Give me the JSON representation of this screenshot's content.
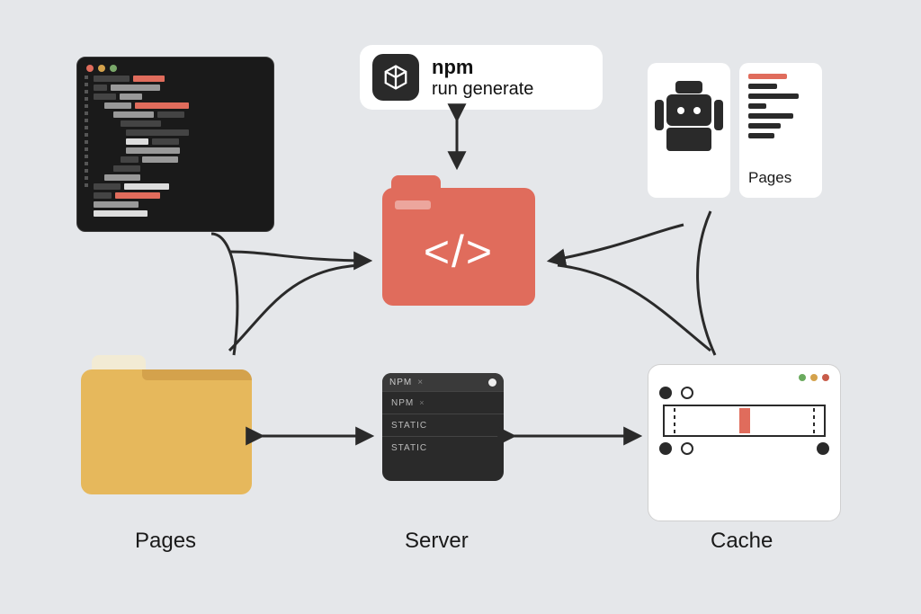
{
  "npm": {
    "cmd": "npm",
    "sub": "run generate"
  },
  "labels": {
    "pages_left": "Pages",
    "server": "Server",
    "cache": "Cache",
    "pages_card": "Pages"
  },
  "server_rows": [
    {
      "label": "NPM",
      "x": true,
      "dot": true
    },
    {
      "label": "NPM",
      "x": true
    },
    {
      "label": "STATIC"
    },
    {
      "label": "STATIC"
    }
  ],
  "diagram": {
    "nodes": [
      "code-editor",
      "npm-command",
      "code-folder",
      "robot-card",
      "pages-card",
      "pages-folder",
      "server-box",
      "cache-window"
    ],
    "edges": [
      {
        "from": "code-editor",
        "to": "code-folder",
        "bidir": false
      },
      {
        "from": "pages-folder",
        "to": "code-folder",
        "bidir": false,
        "via": "code-editor-merge"
      },
      {
        "from": "npm-command",
        "to": "code-folder",
        "bidir": true
      },
      {
        "from": "robot-card",
        "to": "code-folder",
        "bidir": false
      },
      {
        "from": "pages-card",
        "to": "code-folder",
        "bidir": false,
        "via": "robot-merge"
      },
      {
        "from": "pages-folder",
        "to": "server-box",
        "bidir": true
      },
      {
        "from": "server-box",
        "to": "cache-window",
        "bidir": true
      }
    ]
  }
}
